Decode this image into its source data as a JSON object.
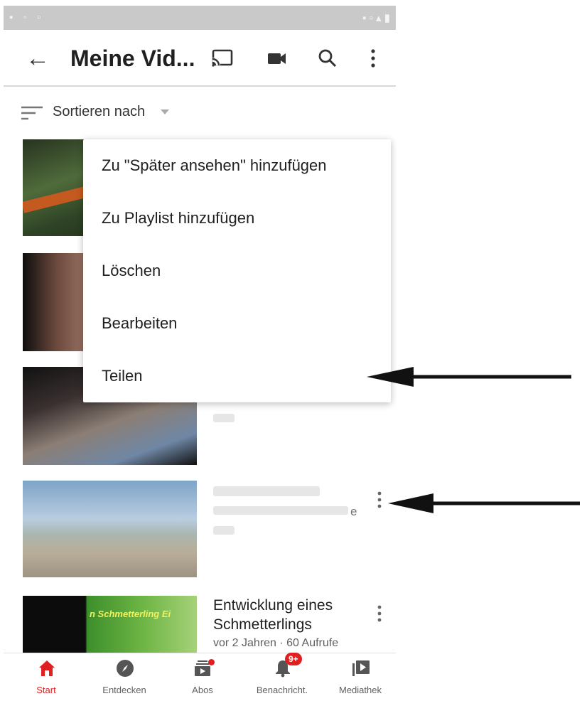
{
  "header": {
    "title": "Meine Vid..."
  },
  "sort": {
    "label": "Sortieren nach"
  },
  "menu": {
    "items": [
      {
        "label": "Zu \"Später ansehen\" hinzufügen"
      },
      {
        "label": "Zu Playlist hinzufügen"
      },
      {
        "label": "Löschen"
      },
      {
        "label": "Bearbeiten"
      },
      {
        "label": "Teilen"
      }
    ]
  },
  "videos": [
    {
      "thumb_label": "n Schmetterling Ei",
      "title": "Entwicklung eines Schmetterlings",
      "meta": "vor 2 Jahren · 60 Aufrufe"
    }
  ],
  "partial_text": {
    "obscured_suffix": "e"
  },
  "nav": {
    "items": [
      {
        "label": "Start",
        "icon": "home-icon"
      },
      {
        "label": "Entdecken",
        "icon": "compass-icon"
      },
      {
        "label": "Abos",
        "icon": "subscriptions-icon"
      },
      {
        "label": "Benachricht.",
        "icon": "bell-icon"
      },
      {
        "label": "Mediathek",
        "icon": "library-icon"
      }
    ],
    "notification_badge": "9+"
  },
  "colors": {
    "accent": "#e02020",
    "text": "#212121",
    "statusbar": "#c9c9c9"
  }
}
